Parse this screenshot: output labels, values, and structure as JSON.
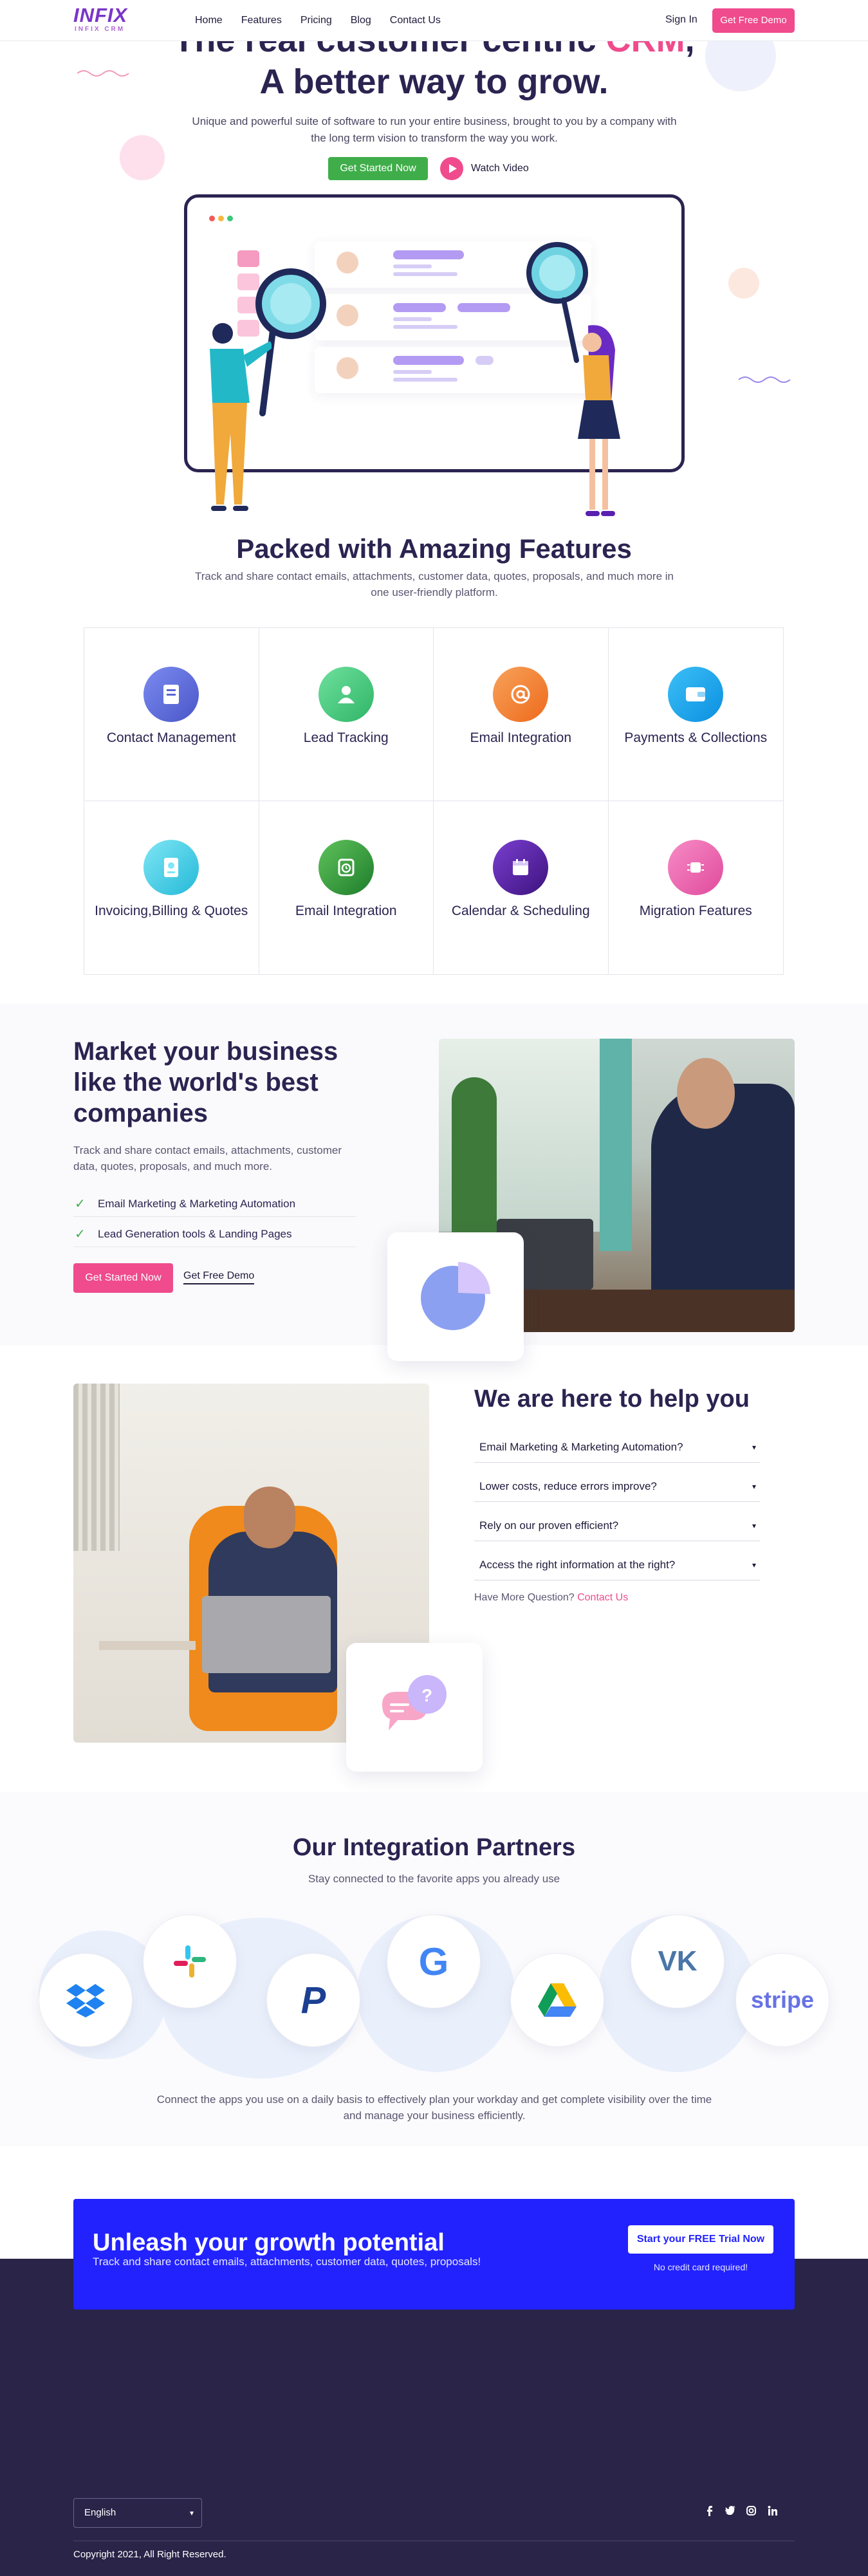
{
  "header": {
    "logo": "INFIX",
    "logo_sub": "INFIX CRM",
    "nav": [
      "Home",
      "Features",
      "Pricing",
      "Blog",
      "Contact Us"
    ],
    "sign_in": "Sign In",
    "demo": "Get Free Demo"
  },
  "hero": {
    "title_line1_a": "The real customer centric ",
    "title_line1_b": "CRM",
    "title_line1_c": ",",
    "title_line2": "A better way to grow.",
    "subtitle": "Unique and powerful suite of software to run your entire business, brought to you by a company with the long term vision to transform the way you work.",
    "cta": "Get Started Now",
    "watch": "Watch Video"
  },
  "features": {
    "title": "Packed with Amazing Features",
    "subtitle": "Track and share contact emails, attachments, customer data, quotes, proposals, and much more in one user-friendly platform.",
    "items": [
      {
        "label": "Contact Management",
        "icon": "contact-book-icon",
        "color": "#5a63d8"
      },
      {
        "label": "Lead Tracking",
        "icon": "user-icon",
        "color": "#3fc77a"
      },
      {
        "label": "Email Integration",
        "icon": "at-sign-icon",
        "color": "#f07a2c"
      },
      {
        "label": "Payments & Collections",
        "icon": "wallet-icon",
        "color": "#1aa7f0"
      },
      {
        "label": "Invoicing,Billing & Quotes",
        "icon": "invoice-icon",
        "color": "#36c7e6"
      },
      {
        "label": "Email Integration",
        "icon": "clock-icon",
        "color": "#2f9b3e"
      },
      {
        "label": "Calendar & Scheduling",
        "icon": "calendar-icon",
        "color": "#5b1fa8"
      },
      {
        "label": "Migration Features",
        "icon": "chip-icon",
        "color": "#e85aa8"
      }
    ]
  },
  "market": {
    "title": "Market your business like the world's best companies",
    "text": "Track and share contact emails, attachments, customer data, quotes, proposals, and much more.",
    "checks": [
      "Email Marketing & Marketing Automation",
      "Lead Generation tools & Landing Pages"
    ],
    "cta": "Get Started Now",
    "demo": "Get Free Demo"
  },
  "help": {
    "title": "We are here to help you",
    "faqs": [
      "Email Marketing & Marketing Automation?",
      "Lower costs, reduce errors improve?",
      "Rely on our proven efficient?",
      "Access the right information at the right?"
    ],
    "question": "Have More Question?",
    "contact": "Contact Us"
  },
  "integration": {
    "title": "Our Integration Partners",
    "subtitle": "Stay connected to the favorite apps you already use",
    "partners": [
      "dropbox-logo",
      "slack-logo",
      "paypal-logo",
      "google-logo",
      "google-drive-logo",
      "vk-logo",
      "stripe-logo"
    ],
    "stripe_text": "stripe",
    "vk_text": "VK",
    "google_text": "G",
    "paypal_text": "P",
    "text": "Connect the apps you use on a daily basis to effectively plan your workday and get complete visibility over the time and manage your business efficiently."
  },
  "cta": {
    "title": "Unleash your growth potential",
    "subtitle": "Track and share contact emails, attachments, customer data, quotes, proposals!",
    "button": "Start your FREE Trial Now",
    "note": "No credit card required!"
  },
  "footer": {
    "language": "English",
    "social": [
      "f",
      "t",
      "ig",
      "in"
    ],
    "copyright": "Copyright 2021, All Right Reserved."
  },
  "colors": {
    "accent": "#ef4b8d",
    "green": "#3fae4a",
    "navy": "#2b2350",
    "cta_blue": "#2222ff",
    "footer": "#2a2448"
  }
}
